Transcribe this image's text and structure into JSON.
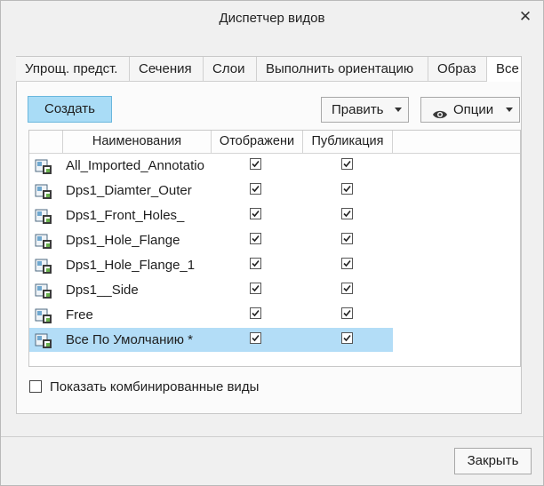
{
  "window": {
    "title": "Диспетчер видов",
    "close_glyph": "✕"
  },
  "tabs": [
    {
      "label": "Упрощ. предст.",
      "active": false
    },
    {
      "label": "Сечения",
      "active": false
    },
    {
      "label": "Слои",
      "active": false
    },
    {
      "label": "Выполнить ориентацию",
      "active": false
    },
    {
      "label": "Образ",
      "active": false
    },
    {
      "label": "Все",
      "active": true
    }
  ],
  "toolbar": {
    "create_label": "Создать",
    "edit_label": "Править",
    "options_label": "Опции",
    "options_icon": "eye-icon"
  },
  "table": {
    "columns": [
      "Наименования",
      "Отображени",
      "Публикация"
    ],
    "rows": [
      {
        "name": "All_Imported_Annotatio",
        "display": true,
        "publish": true,
        "selected": false
      },
      {
        "name": "Dps1_Diamter_Outer",
        "display": true,
        "publish": true,
        "selected": false
      },
      {
        "name": "Dps1_Front_Holes_",
        "display": true,
        "publish": true,
        "selected": false
      },
      {
        "name": "Dps1_Hole_Flange",
        "display": true,
        "publish": true,
        "selected": false
      },
      {
        "name": "Dps1_Hole_Flange_1",
        "display": true,
        "publish": true,
        "selected": false
      },
      {
        "name": "Dps1__Side",
        "display": true,
        "publish": true,
        "selected": false
      },
      {
        "name": "Free",
        "display": true,
        "publish": true,
        "selected": false
      },
      {
        "name": "Все По Умолчанию *",
        "display": true,
        "publish": true,
        "selected": true
      }
    ],
    "row_icon": "combined-view-icon"
  },
  "show_combined": {
    "label": "Показать комбинированные виды",
    "checked": false
  },
  "footer": {
    "close_label": "Закрыть"
  },
  "colors": {
    "selection": "#b3ddf7",
    "create_button": "#a9dcf6"
  }
}
